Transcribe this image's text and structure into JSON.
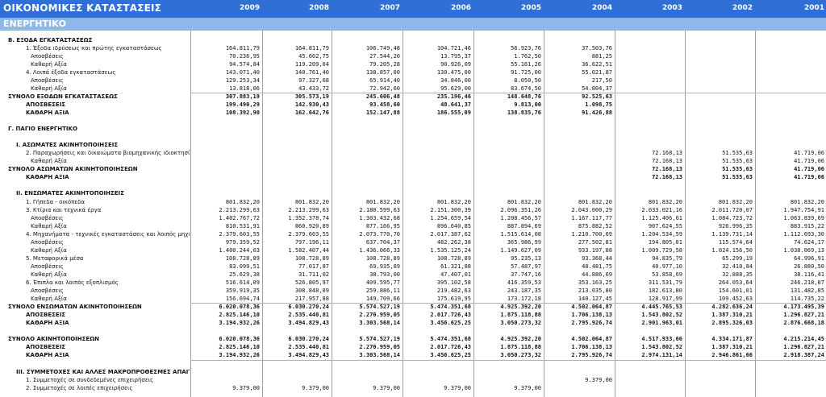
{
  "header": {
    "title": "ΟΙΚΟΝΟΜΙΚΕΣ ΚΑΤΑΣΤΑΣΕΙΣ",
    "years": [
      "2009",
      "2008",
      "2007",
      "2006",
      "2005",
      "2004",
      "2003",
      "2002",
      "2001"
    ]
  },
  "section": {
    "label": "ΕΝΕΡΓΗΤΙΚΟ"
  },
  "colors": {
    "header_bg": "#2f6fd6",
    "section_bg": "#8fb8ea"
  },
  "rows": [
    {
      "label": "Β. ΕΞΟΔΑ ΕΓΚΑΤΑΣΤΑΣΕΩΣ",
      "bold": true,
      "indent": 0,
      "values": [
        "",
        "",
        "",
        "",
        "",
        "",
        "",
        "",
        ""
      ]
    },
    {
      "label": "1. Έξοδα ιδρύσεως και πρώτης εγκαταστάσεως",
      "bold": false,
      "indent": 2,
      "values": [
        "164.811,79",
        "164.811,79",
        "106.749,48",
        "104.721,46",
        "56.923,76",
        "37.503,76",
        "",
        "",
        ""
      ]
    },
    {
      "label": "Αποσβέσεις",
      "bold": false,
      "indent": 3,
      "values": [
        "70.236,95",
        "45.602,75",
        "27.544,20",
        "13.795,37",
        "1.762,50",
        "881,25",
        "",
        "",
        ""
      ]
    },
    {
      "label": "Καθαρή Αξία",
      "bold": false,
      "indent": 3,
      "values": [
        "94.574,84",
        "119.209,04",
        "79.205,28",
        "90.926,09",
        "55.161,26",
        "36.622,51",
        "",
        "",
        ""
      ]
    },
    {
      "label": "4. Λοιπά έξοδα εγκαταστάσεως",
      "bold": false,
      "indent": 2,
      "values": [
        "143.071,40",
        "140.761,40",
        "138.857,00",
        "130.475,00",
        "91.725,00",
        "55.021,87",
        "",
        "",
        ""
      ]
    },
    {
      "label": "Αποσβέσεις",
      "bold": false,
      "indent": 3,
      "values": [
        "129.253,34",
        "97.327,68",
        "65.914,40",
        "34.846,00",
        "8.050,50",
        "217,50",
        "",
        "",
        ""
      ]
    },
    {
      "label": "Καθαρή Αξία",
      "bold": false,
      "indent": 3,
      "values": [
        "13.818,06",
        "43.433,72",
        "72.942,60",
        "95.629,00",
        "83.674,50",
        "54.804,37",
        "",
        "",
        ""
      ]
    },
    {
      "label": "ΣΥΝΟΛΟ ΕΞΟΔΩΝ ΕΓΚΑΤΑΣΤΑΣΕΩΣ",
      "bold": true,
      "indent": 0,
      "values": [
        "307.883,19",
        "305.573,19",
        "245.606,48",
        "235.196,46",
        "148.648,76",
        "92.525,63",
        "",
        "",
        ""
      ]
    },
    {
      "label": "ΑΠΟΣΒΕΣΕΙΣ",
      "bold": true,
      "indent": 2,
      "values": [
        "199.490,29",
        "142.930,43",
        "93.458,60",
        "48.641,37",
        "9.813,00",
        "1.098,75",
        "",
        "",
        ""
      ]
    },
    {
      "label": "ΚΑΘΑΡΗ ΑΞΙΑ",
      "bold": true,
      "indent": 2,
      "values": [
        "108.392,90",
        "162.642,76",
        "152.147,88",
        "186.555,09",
        "138.835,76",
        "91.426,88",
        "",
        "",
        ""
      ]
    },
    {
      "label": "",
      "bold": false,
      "indent": 0,
      "values": [
        "",
        "",
        "",
        "",
        "",
        "",
        "",
        "",
        ""
      ]
    },
    {
      "label": "Γ. ΠΑΓΙΟ ΕΝΕΡΓΗΤΙΚΟ",
      "bold": true,
      "indent": 0,
      "values": [
        "",
        "",
        "",
        "",
        "",
        "",
        "",
        "",
        ""
      ]
    },
    {
      "label": "",
      "bold": false,
      "indent": 0,
      "values": [
        "",
        "",
        "",
        "",
        "",
        "",
        "",
        "",
        ""
      ]
    },
    {
      "label": "I. ΑΣΩΜΑΤΕΣ ΑΚΙΝΗΤΟΠΟΙΗΣΕΙΣ",
      "bold": true,
      "indent": 1,
      "values": [
        "",
        "",
        "",
        "",
        "",
        "",
        "",
        "",
        ""
      ]
    },
    {
      "label": "2. Παραχωρήσεις και δικαιώματα βιομηχανικής ιδιοκτησίας",
      "bold": false,
      "indent": 2,
      "values": [
        "",
        "",
        "",
        "",
        "",
        "",
        "72.168,13",
        "51.535,63",
        "41.719,06"
      ]
    },
    {
      "label": "Καθαρή Αξία",
      "bold": false,
      "indent": 3,
      "values": [
        "",
        "",
        "",
        "",
        "",
        "",
        "72.168,13",
        "51.535,63",
        "41.719,06"
      ]
    },
    {
      "label": "ΣΥΝΟΛΟ ΑΣΩΜΑΤΩΝ ΑΚΙΝΗΤΟΠΟΙΗΣΕΩΝ",
      "bold": true,
      "indent": 0,
      "values": [
        "",
        "",
        "",
        "",
        "",
        "",
        "72.168,13",
        "51.535,63",
        "41.719,06"
      ]
    },
    {
      "label": "ΚΑΘΑΡΗ ΑΞΙΑ",
      "bold": true,
      "indent": 2,
      "values": [
        "",
        "",
        "",
        "",
        "",
        "",
        "72.168,13",
        "51.535,63",
        "41.719,06"
      ]
    },
    {
      "label": "",
      "bold": false,
      "indent": 0,
      "values": [
        "",
        "",
        "",
        "",
        "",
        "",
        "",
        "",
        ""
      ]
    },
    {
      "label": "II. ΕΝΣΩΜΑΤΕΣ ΑΚΙΝΗΤΟΠΟΙΗΣΕΙΣ",
      "bold": true,
      "indent": 1,
      "values": [
        "",
        "",
        "",
        "",
        "",
        "",
        "",
        "",
        ""
      ]
    },
    {
      "label": "1. Γήπεδα - οικόπεδα",
      "bold": false,
      "indent": 2,
      "values": [
        "801.832,20",
        "801.832,20",
        "801.832,20",
        "801.832,20",
        "801.832,20",
        "801.832,20",
        "801.832,20",
        "801.832,20",
        "801.832,20"
      ]
    },
    {
      "label": "3. Κτίρια και τεχνικά έργα",
      "bold": false,
      "indent": 2,
      "values": [
        "2.213.299,63",
        "2.213.299,63",
        "2.180.599,63",
        "2.151.300,39",
        "2.096.351,26",
        "2.043.000,29",
        "2.033.021,16",
        "2.011.720,07",
        "1.947.754,91"
      ]
    },
    {
      "label": "Αποσβέσεις",
      "bold": false,
      "indent": 3,
      "values": [
        "1.402.767,72",
        "1.352.378,74",
        "1.303.432,68",
        "1.254.659,54",
        "1.208.456,57",
        "1.167.117,77",
        "1.125.406,61",
        "1.084.723,72",
        "1.063.839,69"
      ]
    },
    {
      "label": "Καθαρή Αξία",
      "bold": false,
      "indent": 3,
      "values": [
        "810.531,91",
        "860.920,89",
        "877.166,95",
        "896.640,85",
        "887.894,69",
        "875.882,52",
        "907.624,55",
        "926.996,35",
        "883.915,22"
      ]
    },
    {
      "label": "4. Μηχανήματα - τεχνικές εγκαταστάσεις και λοιπός μηχανολογικ",
      "bold": false,
      "indent": 2,
      "values": [
        "2.379.603,55",
        "2.379.603,55",
        "2.073.770,70",
        "2.017.387,62",
        "1.515.614,08",
        "1.210.700,69",
        "1.204.534,59",
        "1.139.731,14",
        "1.112.693,30"
      ]
    },
    {
      "label": "Αποσβέσεις",
      "bold": false,
      "indent": 3,
      "values": [
        "979.359,52",
        "797.196,11",
        "637.704,37",
        "482.262,38",
        "365.986,99",
        "277.502,81",
        "194.805,01",
        "115.574,64",
        "74.624,17"
      ]
    },
    {
      "label": "Καθαρή Αξία",
      "bold": false,
      "indent": 3,
      "values": [
        "1.400.244,03",
        "1.582.407,44",
        "1.436.066,33",
        "1.535.125,24",
        "1.149.627,09",
        "933.197,88",
        "1.009.729,58",
        "1.024.156,50",
        "1.038.069,13"
      ]
    },
    {
      "label": "5. Μεταφορικά μέσα",
      "bold": false,
      "indent": 2,
      "values": [
        "108.728,89",
        "108.728,89",
        "108.728,89",
        "108.728,89",
        "95.235,13",
        "93.368,44",
        "94.835,79",
        "65.299,19",
        "64.996,91"
      ]
    },
    {
      "label": "Αποσβέσεις",
      "bold": false,
      "indent": 3,
      "values": [
        "83.099,51",
        "77.017,87",
        "69.935,89",
        "61.321,88",
        "57.487,97",
        "48.481,75",
        "40.977,10",
        "32.410,84",
        "26.880,50"
      ]
    },
    {
      "label": "Καθαρή Αξία",
      "bold": false,
      "indent": 3,
      "values": [
        "25.629,38",
        "31.711,02",
        "38.793,00",
        "47.407,01",
        "37.747,16",
        "44.886,69",
        "53.858,69",
        "32.888,35",
        "38.116,41"
      ]
    },
    {
      "label": "6. Έπιπλα και λοιπός εξοπλισμός",
      "bold": false,
      "indent": 2,
      "values": [
        "516.614,09",
        "526.805,97",
        "409.595,77",
        "395.102,58",
        "416.359,53",
        "353.163,25",
        "311.531,79",
        "264.053,64",
        "246.218,07"
      ]
    },
    {
      "label": "Αποσβέσεις",
      "bold": false,
      "indent": 3,
      "values": [
        "359.919,35",
        "308.848,09",
        "259.886,11",
        "219.482,63",
        "243.187,35",
        "213.035,80",
        "182.613,80",
        "154.601,01",
        "131.482,85"
      ]
    },
    {
      "label": "Καθαρή Αξία",
      "bold": false,
      "indent": 3,
      "values": [
        "156.694,74",
        "217.957,88",
        "149.709,66",
        "175.619,95",
        "173.172,18",
        "140.127,45",
        "128.917,99",
        "109.452,63",
        "114.735,22"
      ]
    },
    {
      "label": "ΣΥΝΟΛΟ ΕΝΣΩΜΑΤΩΝ ΑΚΙΝΗΤΟΠΟΙΗΣΕΩΝ",
      "bold": true,
      "indent": 0,
      "values": [
        "6.020.078,36",
        "6.030.270,24",
        "5.574.527,19",
        "5.474.351,68",
        "4.925.392,20",
        "4.502.064,87",
        "4.445.765,53",
        "4.282.636,24",
        "4.173.495,39"
      ]
    },
    {
      "label": "ΑΠΟΣΒΕΣΕΙΣ",
      "bold": true,
      "indent": 2,
      "values": [
        "2.825.146,10",
        "2.535.440,81",
        "2.270.959,05",
        "2.017.726,43",
        "1.875.118,88",
        "1.706.138,13",
        "1.543.802,52",
        "1.387.310,21",
        "1.296.827,21"
      ]
    },
    {
      "label": "ΚΑΘΑΡΗ ΑΞΙΑ",
      "bold": true,
      "indent": 2,
      "values": [
        "3.194.932,26",
        "3.494.829,43",
        "3.303.568,14",
        "3.456.625,25",
        "3.050.273,32",
        "2.795.926,74",
        "2.901.963,01",
        "2.895.326,03",
        "2.876.668,18"
      ]
    },
    {
      "label": "",
      "bold": false,
      "indent": 0,
      "values": [
        "",
        "",
        "",
        "",
        "",
        "",
        "",
        "",
        ""
      ]
    },
    {
      "label": "ΣΥΝΟΛΟ ΑΚΙΝΗΤΟΠΟΙΗΣΕΩΝ",
      "bold": true,
      "indent": 0,
      "values": [
        "6.020.078,36",
        "6.030.270,24",
        "5.574.527,19",
        "5.474.351,68",
        "4.925.392,20",
        "4.502.064,87",
        "4.517.933,66",
        "4.334.171,87",
        "4.215.214,45"
      ]
    },
    {
      "label": "ΑΠΟΣΒΕΣΕΙΣ",
      "bold": true,
      "indent": 2,
      "values": [
        "2.825.146,10",
        "2.535.440,81",
        "2.270.959,05",
        "2.017.726,43",
        "1.875.118,88",
        "1.706.138,13",
        "1.543.802,52",
        "1.387.310,21",
        "1.296.827,21"
      ]
    },
    {
      "label": "ΚΑΘΑΡΗ ΑΞΙΑ",
      "bold": true,
      "indent": 2,
      "values": [
        "3.194.932,26",
        "3.494.829,43",
        "3.303.568,14",
        "3.456.625,25",
        "3.050.273,32",
        "2.795.926,74",
        "2.974.131,14",
        "2.946.861,66",
        "2.918.387,24"
      ]
    },
    {
      "label": "",
      "bold": false,
      "indent": 0,
      "values": [
        "",
        "",
        "",
        "",
        "",
        "",
        "",
        "",
        ""
      ]
    },
    {
      "label": "III. ΣΥΜΜΕΤΟΧΕΣ ΚΑΙ ΑΛΛΕΣ ΜΑΚΡΟΠΡΟΘΕΣΜΕΣ ΑΠΑΙΤΗΣΕΙΣ",
      "bold": true,
      "indent": 1,
      "values": [
        "",
        "",
        "",
        "",
        "",
        "",
        "",
        "",
        ""
      ]
    },
    {
      "label": "1. Συμμετοχές σε συνδεδεμένες επιχειρήσεις",
      "bold": false,
      "indent": 2,
      "values": [
        "",
        "",
        "",
        "",
        "",
        "9.379,00",
        "",
        "",
        ""
      ]
    },
    {
      "label": "2. Συμμετοχές σε λοιπές επιχειρήσεις",
      "bold": false,
      "indent": 2,
      "values": [
        "9.379,00",
        "9.379,00",
        "9.379,00",
        "9.379,00",
        "9.379,00",
        "",
        "",
        "",
        ""
      ]
    }
  ]
}
